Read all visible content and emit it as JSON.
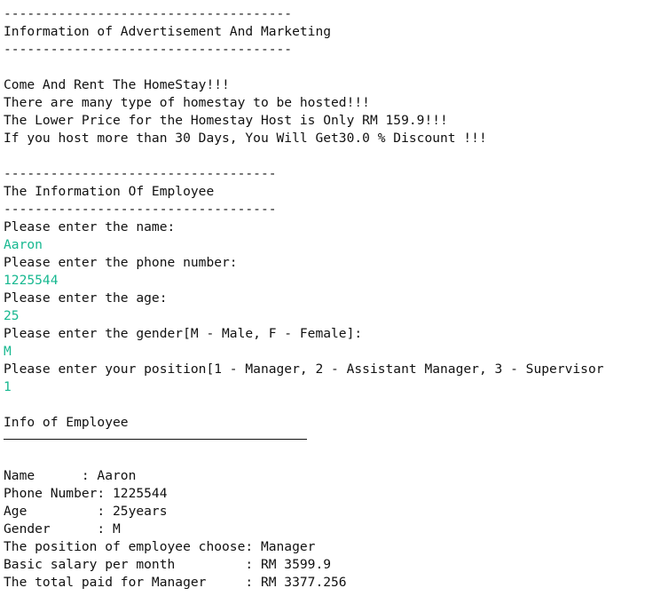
{
  "console": {
    "header": {
      "rule_top": "-------------------------------------",
      "title": "Information of Advertisement And Marketing",
      "rule_bottom": "-------------------------------------"
    },
    "ad": {
      "line1": "Come And Rent The HomeStay!!!",
      "line2": "There are many type of homestay to be hosted!!!",
      "line3": "The Lower Price for the Homestay Host is Only RM 159.9!!!",
      "line4": "If you host more than 30 Days, You Will Get30.0 % Discount !!!"
    },
    "employee_header": {
      "rule_top": "-----------------------------------",
      "title": "The Information Of Employee",
      "rule_bottom": "-----------------------------------"
    },
    "prompts": {
      "name": "Please enter the name:",
      "name_value": "Aaron",
      "phone": "Please enter the phone number:",
      "phone_value": "1225544",
      "age": "Please enter the age:",
      "age_value": "25",
      "gender": "Please enter the gender[M - Male, F - Female]:",
      "gender_value": "M",
      "position": "Please enter your position[1 - Manager, 2 - Assistant Manager, 3 - Supervisor",
      "position_value": "1"
    },
    "info": {
      "title": "Info of Employee",
      "name": "Name      : Aaron",
      "phone": "Phone Number: 1225544",
      "age": "Age         : 25years",
      "gender": "Gender      : M",
      "position": "The position of employee choose: Manager",
      "salary": "Basic salary per month         : RM 3599.9",
      "total": "The total paid for Manager     : RM 3377.256"
    },
    "colors": {
      "text": "#111111",
      "input": "#17b890",
      "background": "#ffffff"
    }
  }
}
